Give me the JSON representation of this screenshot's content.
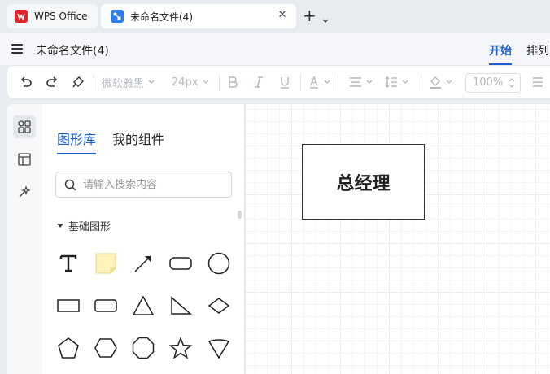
{
  "tabs": [
    {
      "label": "WPS Office",
      "icon": "wps-logo-icon"
    },
    {
      "label": "未命名文件(4)",
      "icon": "diagram-file-icon",
      "active": true
    }
  ],
  "title_bar": {
    "doc_title": "未命名文件(4)",
    "ribbon_tabs": [
      "开始",
      "排列"
    ],
    "active_ribbon_tab": "开始"
  },
  "toolbar": {
    "font_family": "微软雅黑",
    "font_size": "24px",
    "zoom": "100%",
    "buttons": [
      "undo-icon",
      "redo-icon",
      "format-painter-icon",
      "bold-icon",
      "italic-icon",
      "underline-icon",
      "font-color-icon",
      "align-icon",
      "line-spacing-icon",
      "fill-color-icon",
      "text-style-icon"
    ]
  },
  "left_rail": [
    "shapes-icon",
    "templates-icon",
    "magic-icon"
  ],
  "panel": {
    "tabs": [
      "图形库",
      "我的组件"
    ],
    "active_tab": "图形库",
    "search_placeholder": "请输入搜索内容",
    "section_title": "基础图形",
    "shapes": [
      "text",
      "note",
      "arrow",
      "rounded-rectangle",
      "circle",
      "rectangle",
      "rounded-rect-small",
      "triangle",
      "right-triangle",
      "diamond",
      "pentagon",
      "hexagon",
      "octagon",
      "star",
      "shield"
    ]
  },
  "canvas": {
    "node_label": "总经理"
  },
  "colors": {
    "accent": "#1b5fd1",
    "wps_red": "#e4262b",
    "doc_blue": "#2b7de9"
  }
}
